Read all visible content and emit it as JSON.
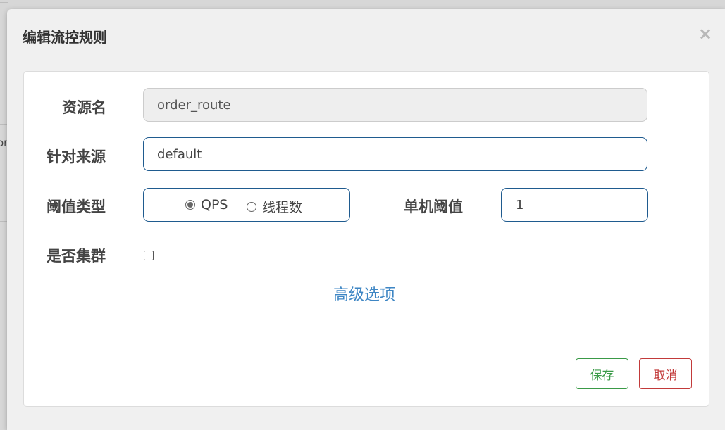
{
  "background": {
    "partial_text": "or"
  },
  "dialog": {
    "title": "编辑流控规则",
    "close_label": "×"
  },
  "form": {
    "resource": {
      "label": "资源名",
      "value": "order_route"
    },
    "limit_app": {
      "label": "针对来源",
      "value": "default"
    },
    "grade": {
      "label": "阈值类型",
      "options": [
        {
          "label": "QPS",
          "checked": true
        },
        {
          "label": "线程数",
          "checked": false
        }
      ]
    },
    "count": {
      "label": "单机阈值",
      "value": "1"
    },
    "cluster": {
      "label": "是否集群",
      "checked": false
    },
    "advanced_label": "高级选项"
  },
  "actions": {
    "save_label": "保存",
    "cancel_label": "取消"
  },
  "colors": {
    "input_border": "#1f5b8f",
    "link": "#3e86c4",
    "save": "#3a9a47",
    "cancel": "#c23a3a"
  }
}
